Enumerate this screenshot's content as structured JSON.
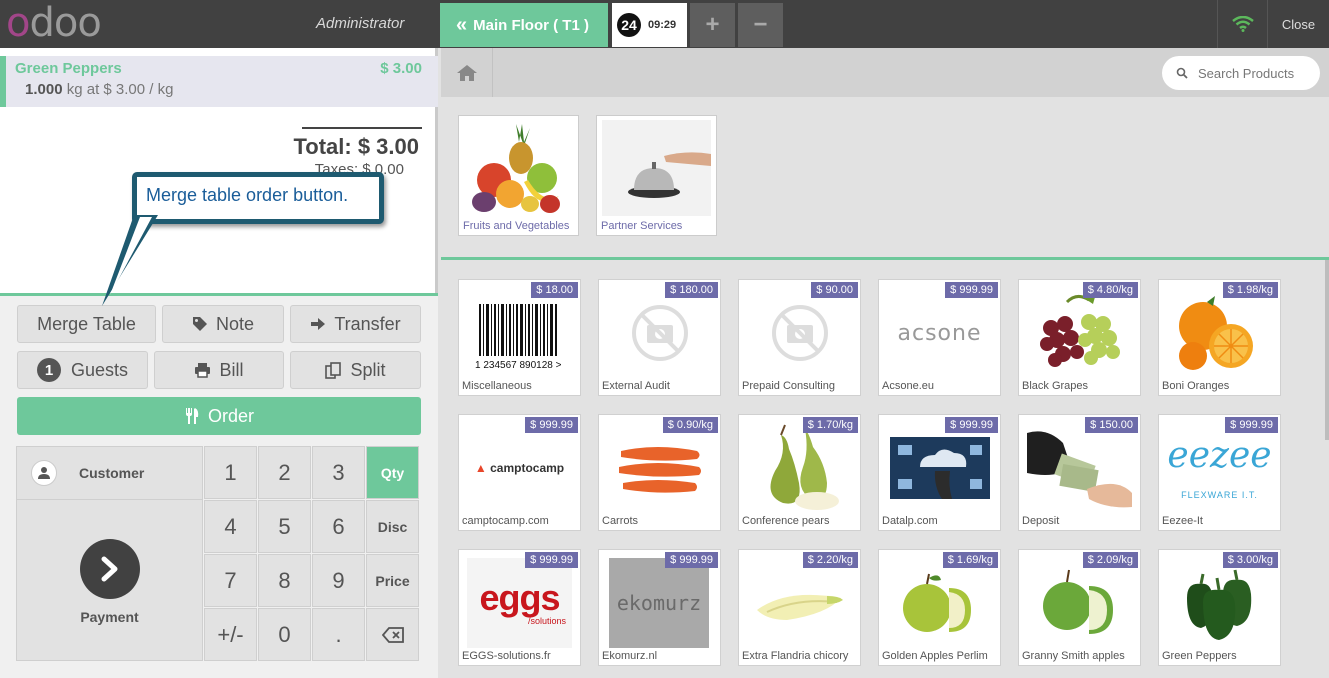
{
  "topbar": {
    "logo": "odoo",
    "user": "Administrator",
    "floor_button": "Main Floor ( T1 )",
    "order_tab": {
      "number": "24",
      "time": "09:29"
    },
    "add_order": "+",
    "remove_order": "−",
    "close": "Close"
  },
  "order": {
    "line": {
      "name": "Green Peppers",
      "price": "$ 3.00",
      "qty": "1.000",
      "unit_info": "kg at $ 3.00 / kg"
    },
    "total": "Total: $ 3.00",
    "taxes": "Taxes: $ 0.00"
  },
  "annotation": "Merge table order button.",
  "controls": {
    "merge_table": "Merge Table",
    "note": "Note",
    "transfer": "Transfer",
    "guests_count": "1",
    "guests": "Guests",
    "bill": "Bill",
    "split": "Split",
    "order": "Order",
    "customer": "Customer",
    "payment": "Payment"
  },
  "numpad": {
    "keys": [
      "1",
      "2",
      "3",
      "4",
      "5",
      "6",
      "7",
      "8",
      "9",
      "+/-",
      "0",
      "."
    ],
    "modes": [
      "Qty",
      "Disc",
      "Price"
    ],
    "active_mode": "Qty"
  },
  "search": {
    "placeholder": "Search Products"
  },
  "categories": [
    {
      "name": "Fruits and Vegetables"
    },
    {
      "name": "Partner Services"
    }
  ],
  "products": [
    {
      "name": "Miscellaneous",
      "price": "$ 18.00",
      "img": "barcode"
    },
    {
      "name": "External Audit",
      "price": "$ 180.00",
      "img": "no-image"
    },
    {
      "name": "Prepaid Consulting",
      "price": "$ 90.00",
      "img": "no-image"
    },
    {
      "name": "Acsone.eu",
      "price": "$ 999.99",
      "img": "acsone-logo"
    },
    {
      "name": "Black Grapes",
      "price": "$ 4.80/kg",
      "img": "grapes"
    },
    {
      "name": "Boni Oranges",
      "price": "$ 1.98/kg",
      "img": "oranges"
    },
    {
      "name": "camptocamp.com",
      "price": "$ 999.99",
      "img": "camptocamp-logo"
    },
    {
      "name": "Carrots",
      "price": "$ 0.90/kg",
      "img": "carrots"
    },
    {
      "name": "Conference pears",
      "price": "$ 1.70/kg",
      "img": "pears"
    },
    {
      "name": "Datalp.com",
      "price": "$ 999.99",
      "img": "datalp"
    },
    {
      "name": "Deposit",
      "price": "$ 150.00",
      "img": "deposit"
    },
    {
      "name": "Eezee-It",
      "price": "$ 999.99",
      "img": "eezee-logo"
    },
    {
      "name": "EGGS-solutions.fr",
      "price": "$ 999.99",
      "img": "eggs-logo"
    },
    {
      "name": "Ekomurz.nl",
      "price": "$ 999.99",
      "img": "ekomurz"
    },
    {
      "name": "Extra Flandria chicory",
      "price": "$ 2.20/kg",
      "img": "chicory"
    },
    {
      "name": "Golden Apples Perlim",
      "price": "$ 1.69/kg",
      "img": "apples"
    },
    {
      "name": "Granny Smith apples",
      "price": "$ 2.09/kg",
      "img": "green-apples"
    },
    {
      "name": "Green Peppers",
      "price": "$ 3.00/kg",
      "img": "peppers"
    }
  ],
  "logo_text": {
    "acsone": "acsone",
    "camptocamp": "camptocamp",
    "eezee": "eezee",
    "flexware": "FLEXWARE I.T.",
    "eggs": "eggs",
    "eggs_sub": "/solutions",
    "ekomurz": "ekomurz",
    "barcode_digits": "1 234567 890128 >"
  },
  "colors": {
    "accent": "#6ec89b",
    "price_badge": "#6d6ba9",
    "topbar": "#414141"
  }
}
